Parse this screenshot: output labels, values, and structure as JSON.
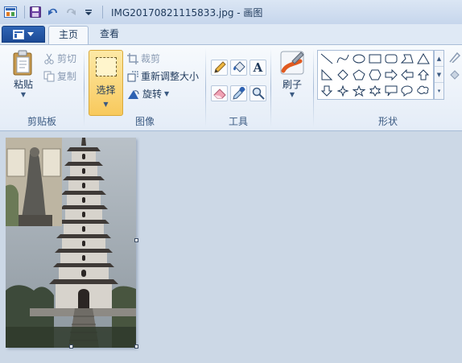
{
  "window": {
    "title": "IMG20170821115833.jpg - 画图"
  },
  "tabs": [
    {
      "label": "主页"
    },
    {
      "label": "查看"
    }
  ],
  "clipboard": {
    "paste_label": "粘贴",
    "cut_label": "剪切",
    "copy_label": "复制",
    "group_label": "剪贴板"
  },
  "image_group": {
    "select_label": "选择",
    "crop_label": "裁剪",
    "resize_label": "重新调整大小",
    "rotate_label": "旋转",
    "group_label": "图像"
  },
  "tools": {
    "group_label": "工具",
    "text_glyph": "A"
  },
  "brushes": {
    "label": "刷子"
  },
  "shapes": {
    "group_label": "形状"
  },
  "colors": {
    "accent": "#f8c95c",
    "file_button": "#2f65b5"
  }
}
